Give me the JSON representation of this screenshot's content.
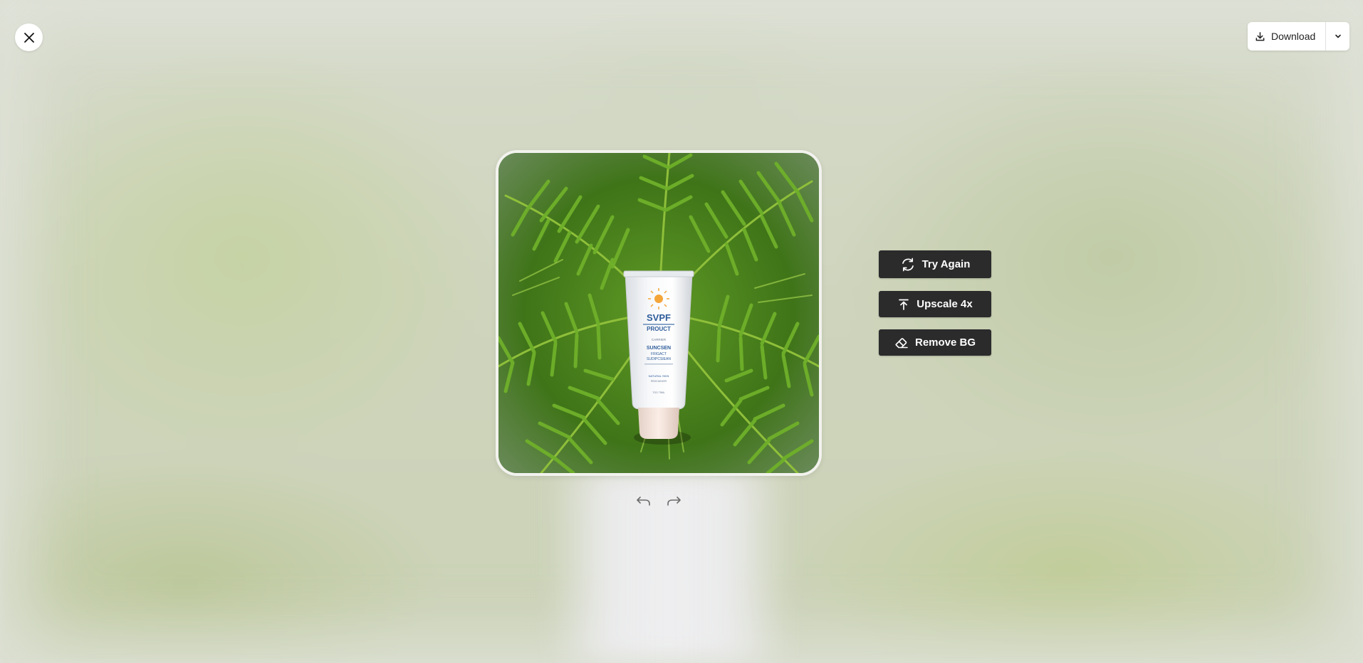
{
  "toolbar": {
    "download_label": "Download",
    "close_icon": "close-icon",
    "download_icon": "download-icon",
    "caret_icon": "chevron-down-icon"
  },
  "preview": {
    "product": {
      "brand": "SVPF",
      "line1": "PROUCT",
      "small1": "CARRIER",
      "name1": "SUNCSEN",
      "name2": "FRIGACT",
      "name3": "SUDIPCSIEAN",
      "fine1": "NATURAL SKIN",
      "fine2": "REDCIANIOR",
      "fine3": "TOO 75ML"
    }
  },
  "actions": {
    "try_again": "Try Again",
    "upscale": "Upscale 4x",
    "remove_bg": "Remove BG"
  },
  "history": {
    "undo_icon": "undo-icon",
    "redo_icon": "redo-icon"
  }
}
